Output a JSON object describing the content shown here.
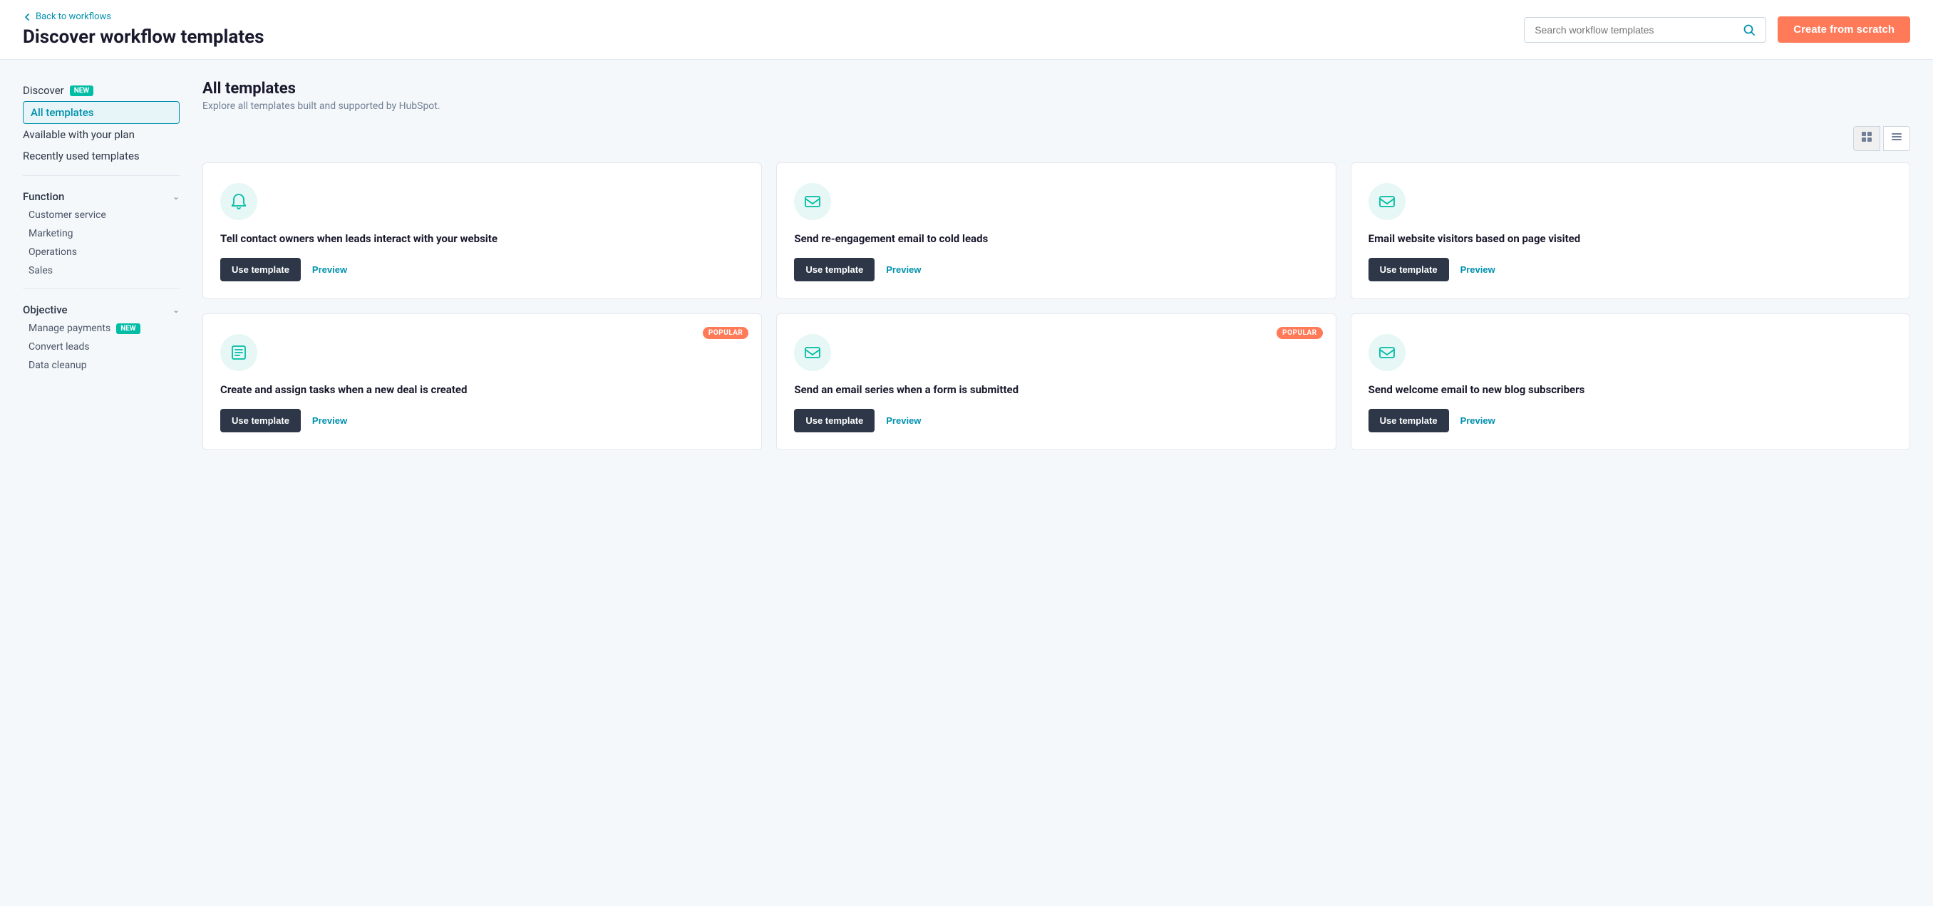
{
  "header": {
    "back_label": "Back to workflows",
    "page_title": "Discover workflow templates",
    "search_placeholder": "Search workflow templates",
    "create_button_label": "Create from scratch"
  },
  "sidebar": {
    "discover_label": "Discover",
    "discover_badge": "NEW",
    "all_templates_label": "All templates",
    "available_plan_label": "Available with your plan",
    "recently_used_label": "Recently used templates",
    "function_label": "Function",
    "function_items": [
      {
        "label": "Customer service"
      },
      {
        "label": "Marketing"
      },
      {
        "label": "Operations"
      },
      {
        "label": "Sales"
      }
    ],
    "objective_label": "Objective",
    "objective_items": [
      {
        "label": "Manage payments",
        "badge": "NEW"
      },
      {
        "label": "Convert leads"
      },
      {
        "label": "Data cleanup"
      }
    ]
  },
  "content": {
    "title": "All templates",
    "subtitle": "Explore all templates built and supported by HubSpot.",
    "view_grid_label": "Grid view",
    "view_list_label": "List view"
  },
  "templates": [
    {
      "id": 1,
      "icon": "bell",
      "title": "Tell contact owners when leads interact with your website",
      "popular": false,
      "use_label": "Use template",
      "preview_label": "Preview"
    },
    {
      "id": 2,
      "icon": "email",
      "title": "Send re-engagement email to cold leads",
      "popular": false,
      "use_label": "Use template",
      "preview_label": "Preview"
    },
    {
      "id": 3,
      "icon": "email",
      "title": "Email website visitors based on page visited",
      "popular": false,
      "use_label": "Use template",
      "preview_label": "Preview"
    },
    {
      "id": 4,
      "icon": "tasks",
      "title": "Create and assign tasks when a new deal is created",
      "popular": true,
      "popular_label": "POPULAR",
      "use_label": "Use template",
      "preview_label": "Preview"
    },
    {
      "id": 5,
      "icon": "email",
      "title": "Send an email series when a form is submitted",
      "popular": true,
      "popular_label": "POPULAR",
      "use_label": "Use template",
      "preview_label": "Preview"
    },
    {
      "id": 6,
      "icon": "email",
      "title": "Send welcome email to new blog subscribers",
      "popular": false,
      "use_label": "Use template",
      "preview_label": "Preview"
    }
  ]
}
